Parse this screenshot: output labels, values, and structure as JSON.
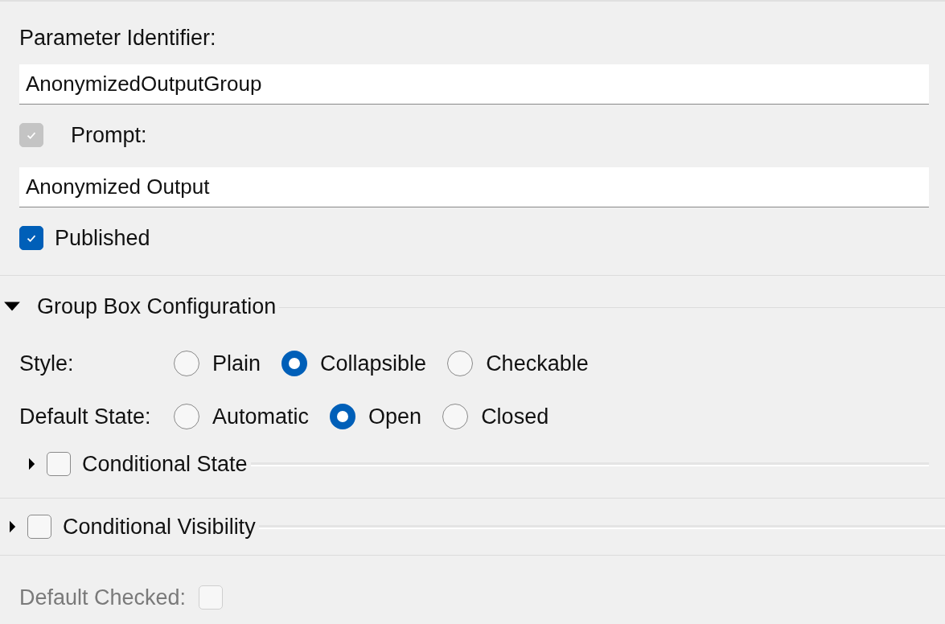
{
  "identifier": {
    "label": "Parameter Identifier:",
    "value": "AnonymizedOutputGroup"
  },
  "prompt": {
    "label": "Prompt:",
    "checked": true,
    "disabled": true,
    "value": "Anonymized Output"
  },
  "published": {
    "label": "Published",
    "checked": true
  },
  "group_box": {
    "title": "Group Box Configuration",
    "expanded": true,
    "radio_groups": [
      {
        "label": "Style:",
        "options": [
          {
            "label": "Plain",
            "selected": false
          },
          {
            "label": "Collapsible",
            "selected": true
          },
          {
            "label": "Checkable",
            "selected": false
          }
        ]
      },
      {
        "label": "Default State:",
        "options": [
          {
            "label": "Automatic",
            "selected": false
          },
          {
            "label": "Open",
            "selected": true
          },
          {
            "label": "Closed",
            "selected": false
          }
        ]
      }
    ],
    "conditional_state": {
      "label": "Conditional State",
      "expanded": false,
      "checked": false
    }
  },
  "conditional_visibility": {
    "label": "Conditional Visibility",
    "expanded": false,
    "checked": false
  },
  "default_checked": {
    "label": "Default Checked:",
    "checked": false,
    "disabled": true
  }
}
